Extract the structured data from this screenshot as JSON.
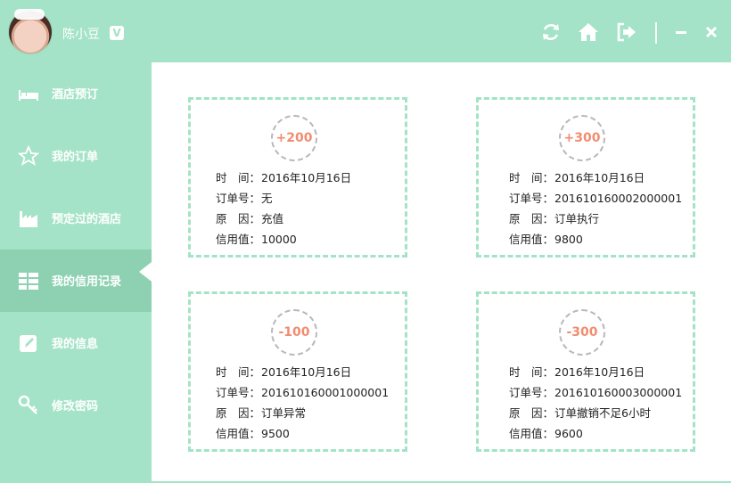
{
  "header": {
    "username": "陈小豆",
    "vip_badge": "V"
  },
  "sidebar": {
    "items": [
      {
        "label": "酒店预订",
        "icon": "bed-icon"
      },
      {
        "label": "我的订单",
        "icon": "star-icon"
      },
      {
        "label": "预定过的酒店",
        "icon": "factory-icon"
      },
      {
        "label": "我的信用记录",
        "icon": "list-icon",
        "active": true
      },
      {
        "label": "我的信息",
        "icon": "pencil-icon"
      },
      {
        "label": "修改密码",
        "icon": "key-icon"
      }
    ]
  },
  "labels": {
    "time": "时　间：",
    "order": "订单号：",
    "reason": "原　因：",
    "credit": "信用值："
  },
  "records": [
    {
      "change": "+200",
      "time": "2016年10月16日",
      "order": "无",
      "reason": "充值",
      "credit": "10000"
    },
    {
      "change": "+300",
      "time": "2016年10月16日",
      "order": "201610160002000001",
      "reason": "订单执行",
      "credit": "9800"
    },
    {
      "change": "-100",
      "time": "2016年10月16日",
      "order": "201610160001000001",
      "reason": "订单异常",
      "credit": "9500"
    },
    {
      "change": "-300",
      "time": "2016年10月16日",
      "order": "201610160003000001",
      "reason": "订单撤销不足6小时",
      "credit": "9600"
    }
  ],
  "colors": {
    "theme": "#a4e3c7",
    "active": "#8dd1b2",
    "change_text": "#f08d70"
  }
}
